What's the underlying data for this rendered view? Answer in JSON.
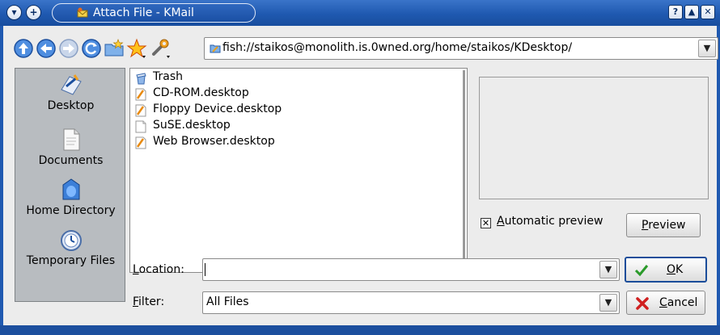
{
  "window": {
    "title": "Attach File - KMail",
    "controls": {
      "help": "?",
      "maximize": "▲",
      "close": "✕"
    }
  },
  "toolbar": {
    "buttons": [
      {
        "name": "up-icon"
      },
      {
        "name": "back-icon"
      },
      {
        "name": "forward-icon"
      },
      {
        "name": "reload-icon"
      },
      {
        "name": "new-folder-icon"
      },
      {
        "name": "bookmarks-icon"
      },
      {
        "name": "configure-icon"
      }
    ],
    "url": "fish://staikos@monolith.is.0wned.org/home/staikos/KDesktop/"
  },
  "sidebar": {
    "places": [
      {
        "label": "Desktop",
        "icon": "desktop-icon"
      },
      {
        "label": "Documents",
        "icon": "documents-icon"
      },
      {
        "label": "Home Directory",
        "icon": "home-icon"
      },
      {
        "label": "Temporary Files",
        "icon": "temp-files-icon"
      }
    ]
  },
  "files": [
    {
      "name": "Trash",
      "icon": "trash-icon"
    },
    {
      "name": "CD-ROM.desktop",
      "icon": "desktop-file-icon"
    },
    {
      "name": "Floppy Device.desktop",
      "icon": "desktop-file-icon"
    },
    {
      "name": "SuSE.desktop",
      "icon": "blank-file-icon"
    },
    {
      "name": "Web Browser.desktop",
      "icon": "desktop-file-icon"
    }
  ],
  "preview": {
    "auto_label_pre": "",
    "auto_label_u": "A",
    "auto_label_rest": "utomatic preview",
    "auto_checked": true,
    "button_u": "P",
    "button_rest": "review"
  },
  "location": {
    "label_u": "L",
    "label_rest": "ocation:",
    "value": ""
  },
  "filter": {
    "label_u": "F",
    "label_rest": "ilter:",
    "value": "All Files"
  },
  "ok": {
    "label_u": "O",
    "label_rest": "K"
  },
  "cancel": {
    "label_u": "C",
    "label_rest": "ancel"
  },
  "colors": {
    "titlebar": "#1f59b0",
    "window_bg": "#ececec",
    "sidebar_bg": "#b8bcc0",
    "focus_border": "#1b4d9a"
  }
}
